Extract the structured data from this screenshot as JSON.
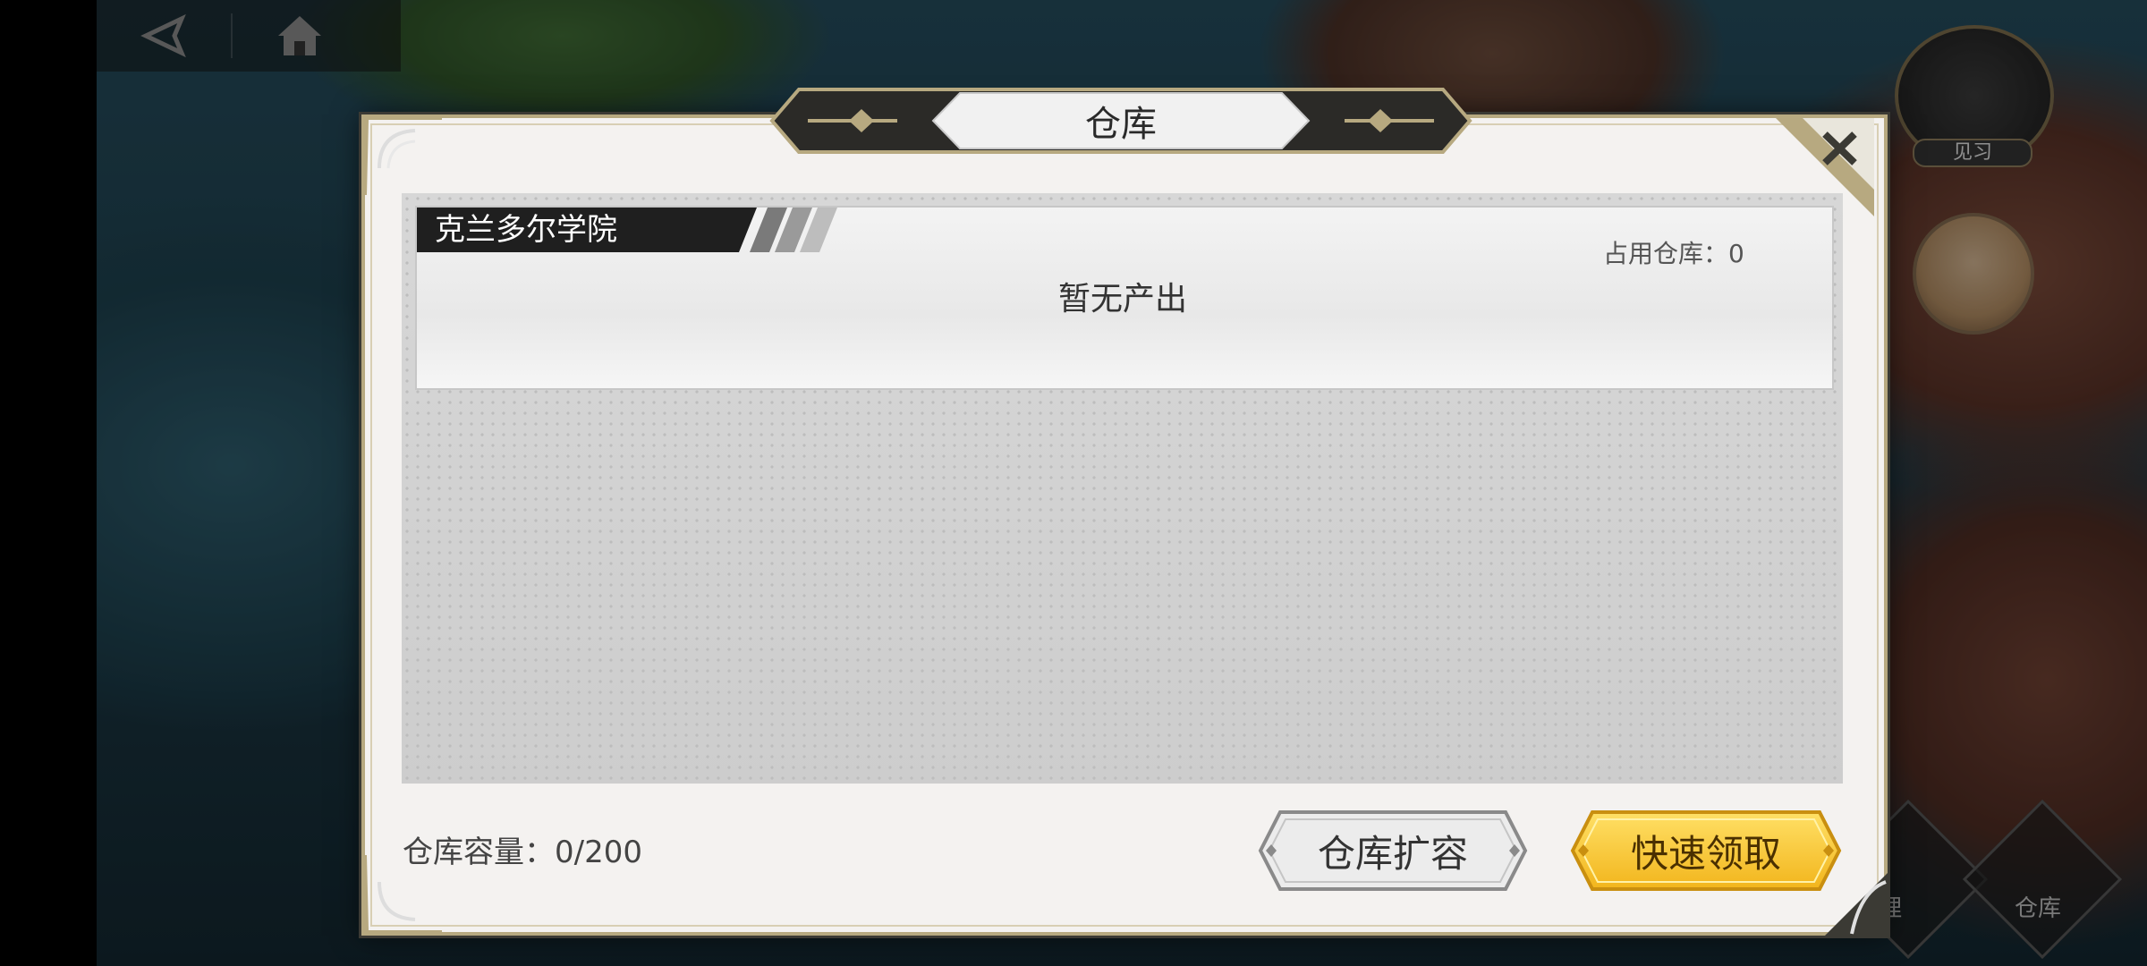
{
  "dialog": {
    "title": "仓库",
    "close_icon": "close-icon"
  },
  "card": {
    "name": "克兰多尔学院",
    "occupy_label": "占用仓库：0",
    "empty_text": "暂无产出"
  },
  "footer": {
    "capacity": "仓库容量：0/200",
    "expand_label": "仓库扩容",
    "claim_label": "快速领取"
  },
  "side": {
    "practice_label": "见习",
    "manage_label": "理",
    "warehouse_label": "仓库"
  },
  "colors": {
    "accent_gold": "#f5c32c",
    "frame_gold": "#b7a980"
  }
}
